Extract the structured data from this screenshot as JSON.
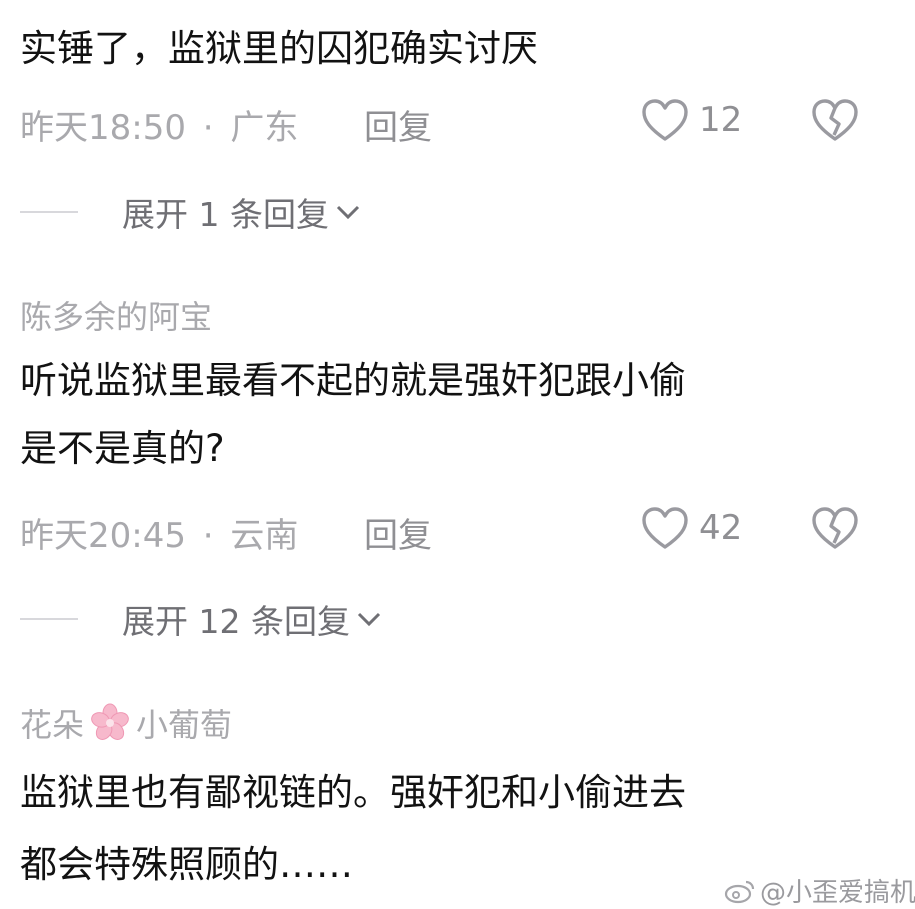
{
  "comments": [
    {
      "username": "",
      "text_lines": [
        "实锤了，监狱里的囚犯确实讨厌"
      ],
      "time": "昨天18:50",
      "location": "广东",
      "reply_label": "回复",
      "likes": "12",
      "expand_label": "展开 1 条回复"
    },
    {
      "username": "陈多余的阿宝",
      "text_lines": [
        "听说监狱里最看不起的就是强奸犯跟小偷",
        "是不是真的?"
      ],
      "time": "昨天20:45",
      "location": "云南",
      "reply_label": "回复",
      "likes": "42",
      "expand_label": "展开 12 条回复"
    },
    {
      "username_parts": [
        "花朵",
        "小葡萄"
      ],
      "text_lines": [
        "监狱里也有鄙视链的。强奸犯和小偷进去",
        "都会特殊照顾的……"
      ]
    }
  ],
  "meta_separator": "·",
  "watermark": "@小歪爱搞机",
  "icons": {
    "like": "heart-outline-icon",
    "dislike": "broken-heart-icon",
    "expand": "chevron-down-icon",
    "flower": "cherry-blossom-icon",
    "weibo": "weibo-logo-icon"
  },
  "colors": {
    "text": "#121212",
    "meta": "#a9a9ad",
    "secondary": "#8f8f93",
    "flower": "#f4a7c0"
  }
}
